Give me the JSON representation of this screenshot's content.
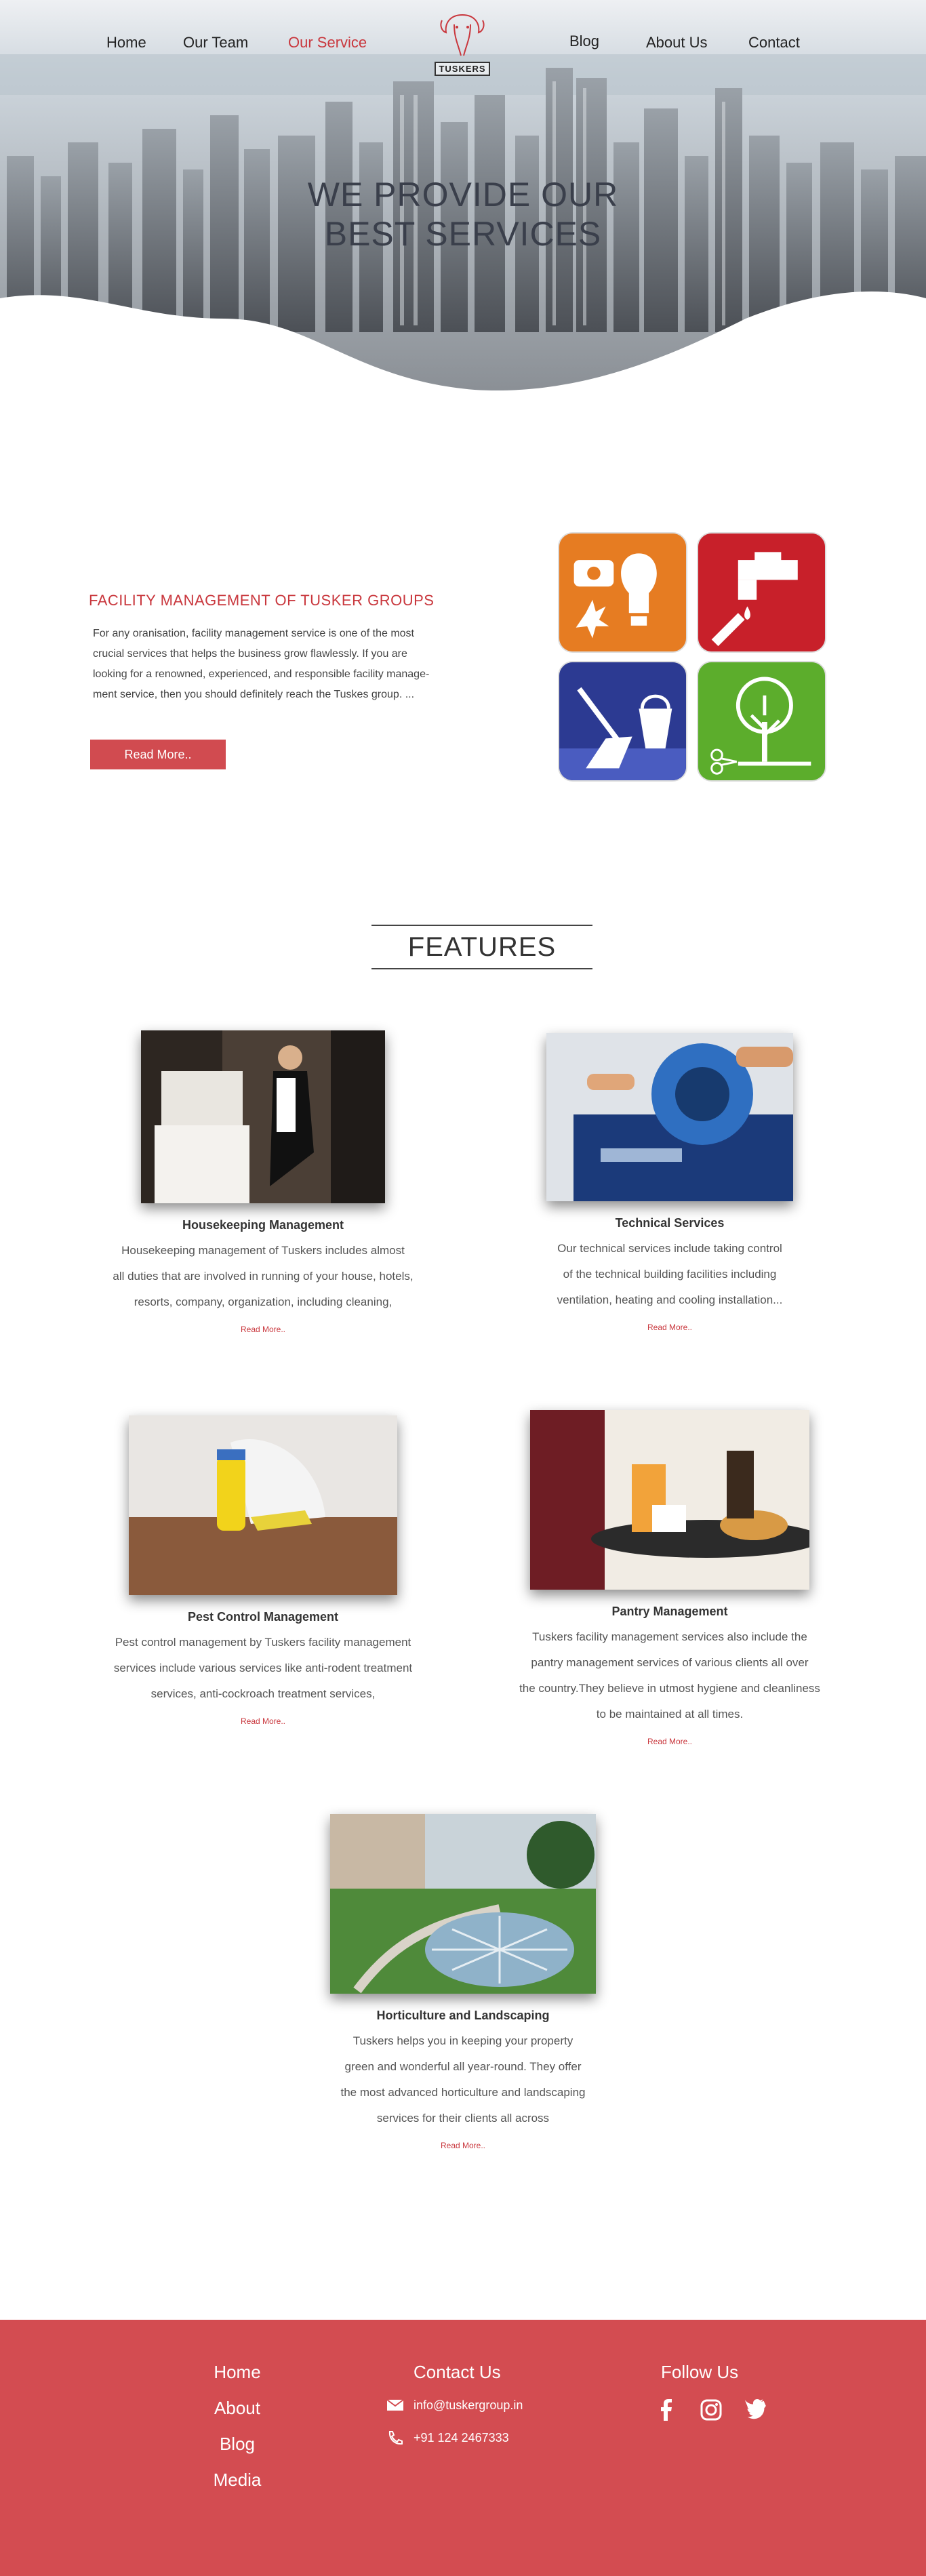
{
  "nav": {
    "home": "Home",
    "team": "Our Team",
    "service": "Our Service",
    "blog": "Blog",
    "about": "About Us",
    "contact": "Contact"
  },
  "logo": {
    "text": "TUSKERS"
  },
  "hero": {
    "title_line1": "WE PROVIDE OUR",
    "title_line2": "BEST SERVICES"
  },
  "intro": {
    "heading": "FACILITY MANAGEMENT OF TUSKER GROUPS",
    "lines": [
      "For any oranisation, facility management service is one of the most",
      "crucial services that helps the business grow flawlessly. If you are",
      "looking for a renowned, experienced, and responsible facility manage-",
      "ment service, then you should definitely reach the Tuskes group. ..."
    ],
    "button": "Read More.."
  },
  "features": {
    "title": "FEATURES",
    "cards": [
      {
        "title": "Housekeeping Management",
        "lines": [
          "Housekeeping management of Tuskers includes almost",
          "all duties that are involved in running of your house, hotels,",
          "resorts, company, organization, including cleaning,"
        ],
        "read": "Read More.."
      },
      {
        "title": "Technical Services",
        "lines": [
          "Our technical services include taking control",
          "of the technical building facilities including",
          "ventilation, heating and cooling installation..."
        ],
        "read": "Read More.."
      },
      {
        "title": "Pest Control Management",
        "lines": [
          "Pest control management by Tuskers facility management",
          "services include various services like anti-rodent treatment",
          "services, anti-cockroach treatment services,"
        ],
        "read": "Read More.."
      },
      {
        "title": "Pantry Management",
        "lines": [
          "Tuskers facility management services also include the",
          "pantry management services of various clients all over",
          "the country.They believe in utmost hygiene and cleanliness",
          "to be maintained at all times."
        ],
        "read": "Read More.."
      },
      {
        "title": "Horticulture and Landscaping",
        "lines": [
          "Tuskers helps you in keeping your property",
          "green and wonderful all year-round. They offer",
          "the most advanced horticulture and landscaping",
          "services for their clients all across"
        ],
        "read": "Read More.."
      }
    ]
  },
  "footer": {
    "links": [
      "Home",
      "About",
      "Blog",
      "Media"
    ],
    "contact_title": "Contact Us",
    "email": "info@tuskergroup.in",
    "phone": "+91 124 2467333",
    "follow_title": "Follow Us",
    "social": [
      "facebook-icon",
      "instagram-icon",
      "twitter-icon"
    ]
  },
  "colors": {
    "accent": "#c9373d",
    "footer": "#d34c51",
    "text": "#333333"
  }
}
